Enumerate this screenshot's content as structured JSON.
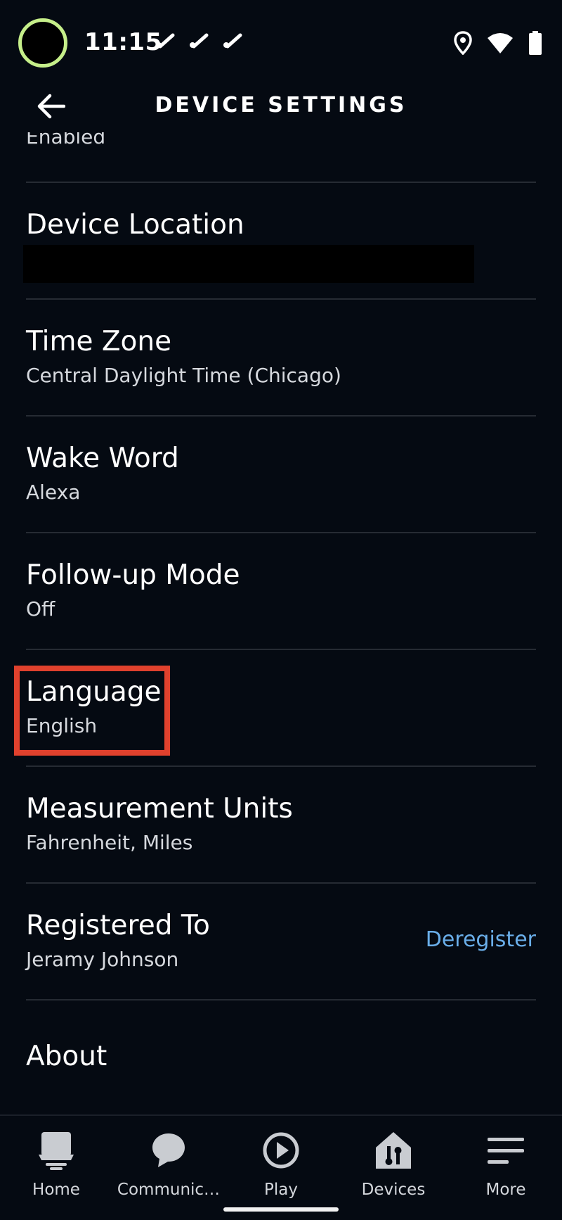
{
  "status_bar": {
    "time": "11:15",
    "avatar_ring_color": "#c6ef8a",
    "icons": [
      "missed-call-icon",
      "missed-call-icon",
      "missed-call-icon",
      "location-icon",
      "wifi-icon",
      "battery-icon"
    ]
  },
  "header": {
    "title": "DEVICE SETTINGS",
    "back_icon": "back-arrow-icon"
  },
  "partial_row": {
    "value": "Enabled"
  },
  "settings": [
    {
      "title": "Device Location",
      "value": ""
    },
    {
      "title": "Time Zone",
      "value": "Central Daylight Time (Chicago)"
    },
    {
      "title": "Wake Word",
      "value": "Alexa"
    },
    {
      "title": "Follow-up Mode",
      "value": "Off"
    },
    {
      "title": "Language",
      "value": "English"
    },
    {
      "title": "Measurement Units",
      "value": "Fahrenheit, Miles"
    },
    {
      "title": "Registered To",
      "value": "Jeramy Johnson",
      "action": "Deregister"
    },
    {
      "title": "About",
      "value": ""
    }
  ],
  "highlight_color": "#e0412d",
  "accent_link_color": "#6aaee9",
  "bottom_nav": {
    "items": [
      {
        "label": "Home",
        "icon": "home-icon"
      },
      {
        "label": "Communic…",
        "icon": "chat-bubble-icon"
      },
      {
        "label": "Play",
        "icon": "play-icon"
      },
      {
        "label": "Devices",
        "icon": "devices-icon"
      },
      {
        "label": "More",
        "icon": "menu-icon"
      }
    ]
  }
}
